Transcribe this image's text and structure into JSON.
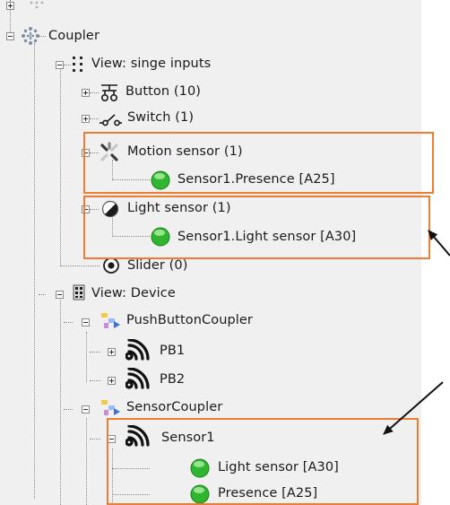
{
  "tree": {
    "coupler": "Coupler",
    "view_single_inputs": "View: singe inputs",
    "button": "Button (10)",
    "switch": "Switch (1)",
    "motion_sensor": "Motion sensor (1)",
    "sensor1_presence": "Sensor1.Presence [A25]",
    "light_sensor": "Light sensor (1)",
    "sensor1_light": "Sensor1.Light sensor [A30]",
    "slider": "Slider (0)",
    "view_device": "View: Device",
    "pushbutton_coupler": "PushButtonCoupler",
    "pb1": "PB1",
    "pb2": "PB2",
    "sensor_coupler": "SensorCoupler",
    "sensor1": "Sensor1",
    "light_sensor_a30": "Light sensor [A30]",
    "presence_a25": "Presence [A25]"
  },
  "colors": {
    "highlight_box": "#ed7d31",
    "status_green": "#2fb52f",
    "panel_bg": "#f0f0f0"
  }
}
